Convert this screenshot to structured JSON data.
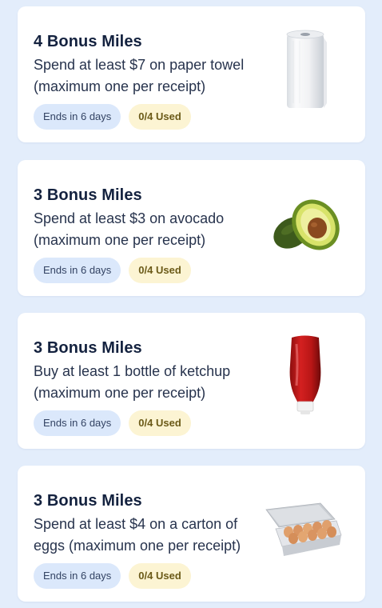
{
  "offers": [
    {
      "title": "4 Bonus Miles",
      "description": "Spend at least $7 on paper towel (maximum one per receipt)",
      "ends": "Ends in 6 days",
      "used": "0/4 Used",
      "image": "paper-towel-roll"
    },
    {
      "title": "3 Bonus Miles",
      "description": "Spend at least $3 on avocado (maximum one per receipt)",
      "ends": "Ends in 6 days",
      "used": "0/4 Used",
      "image": "avocado"
    },
    {
      "title": "3 Bonus Miles",
      "description": "Buy at least 1 bottle of ketchup (maximum one per receipt)",
      "ends": "Ends in 6 days",
      "used": "0/4 Used",
      "image": "ketchup-bottle"
    },
    {
      "title": "3 Bonus Miles",
      "description": "Spend at least $4 on a carton of eggs (maximum one per receipt)",
      "ends": "Ends in 6 days",
      "used": "0/4 Used",
      "image": "egg-carton"
    }
  ],
  "colors": {
    "background": "#e3edfb",
    "card": "#ffffff",
    "title": "#14223f",
    "ends_chip": "#dbe8fb",
    "used_chip": "#fcf4d3"
  }
}
